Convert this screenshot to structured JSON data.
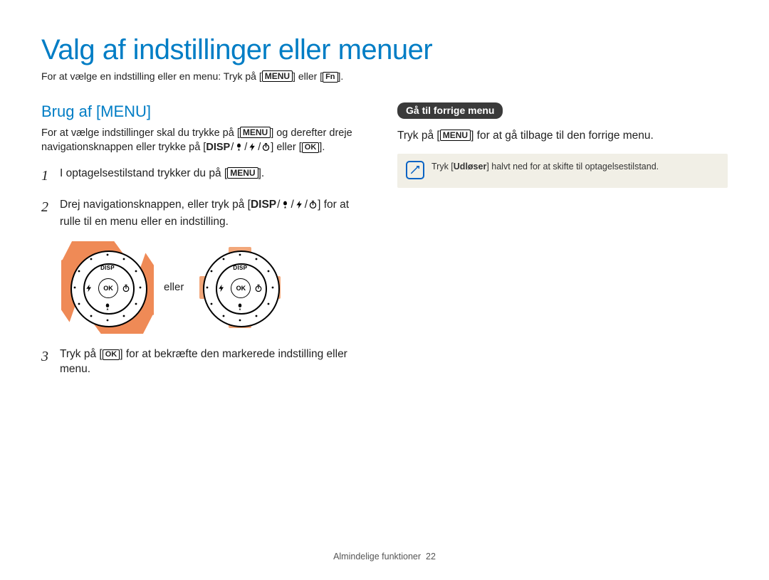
{
  "title": "Valg af indstillinger eller menuer",
  "intro_before": "For at vælge en indstilling eller en menu: Tryk på [",
  "intro_mid": "] eller [",
  "intro_after": "].",
  "labels": {
    "menu": "MENU",
    "fn": "Fn",
    "ok": "OK",
    "disp": "DISP"
  },
  "left": {
    "heading": "Brug af [MENU]",
    "p1_a": "For at vælge indstillinger skal du trykke på [",
    "p1_b": "] og derefter dreje navigationsknappen eller trykke på [",
    "p1_c": "] eller [",
    "p1_d": "].",
    "steps": {
      "s1_a": "I optagelsestilstand trykker du på [",
      "s1_b": "].",
      "s2_a": "Drej navigationsknappen, eller tryk på [",
      "s2_b": "] for at rulle til en menu eller en indstilling.",
      "s3_a": "Tryk på [",
      "s3_b": "] for at bekræfte den markerede indstilling eller menu."
    },
    "eller": "eller",
    "dial": {
      "top": "DISP",
      "center": "OK"
    }
  },
  "right": {
    "pill": "Gå til forrige menu",
    "p_a": "Tryk på [",
    "p_b": "] for at gå tilbage til den forrige menu.",
    "note_a": "Tryk [",
    "note_strong": "Udløser",
    "note_b": "] halvt ned for at skifte til optagelsestilstand."
  },
  "footer": {
    "section": "Almindelige funktioner",
    "page": "22"
  }
}
